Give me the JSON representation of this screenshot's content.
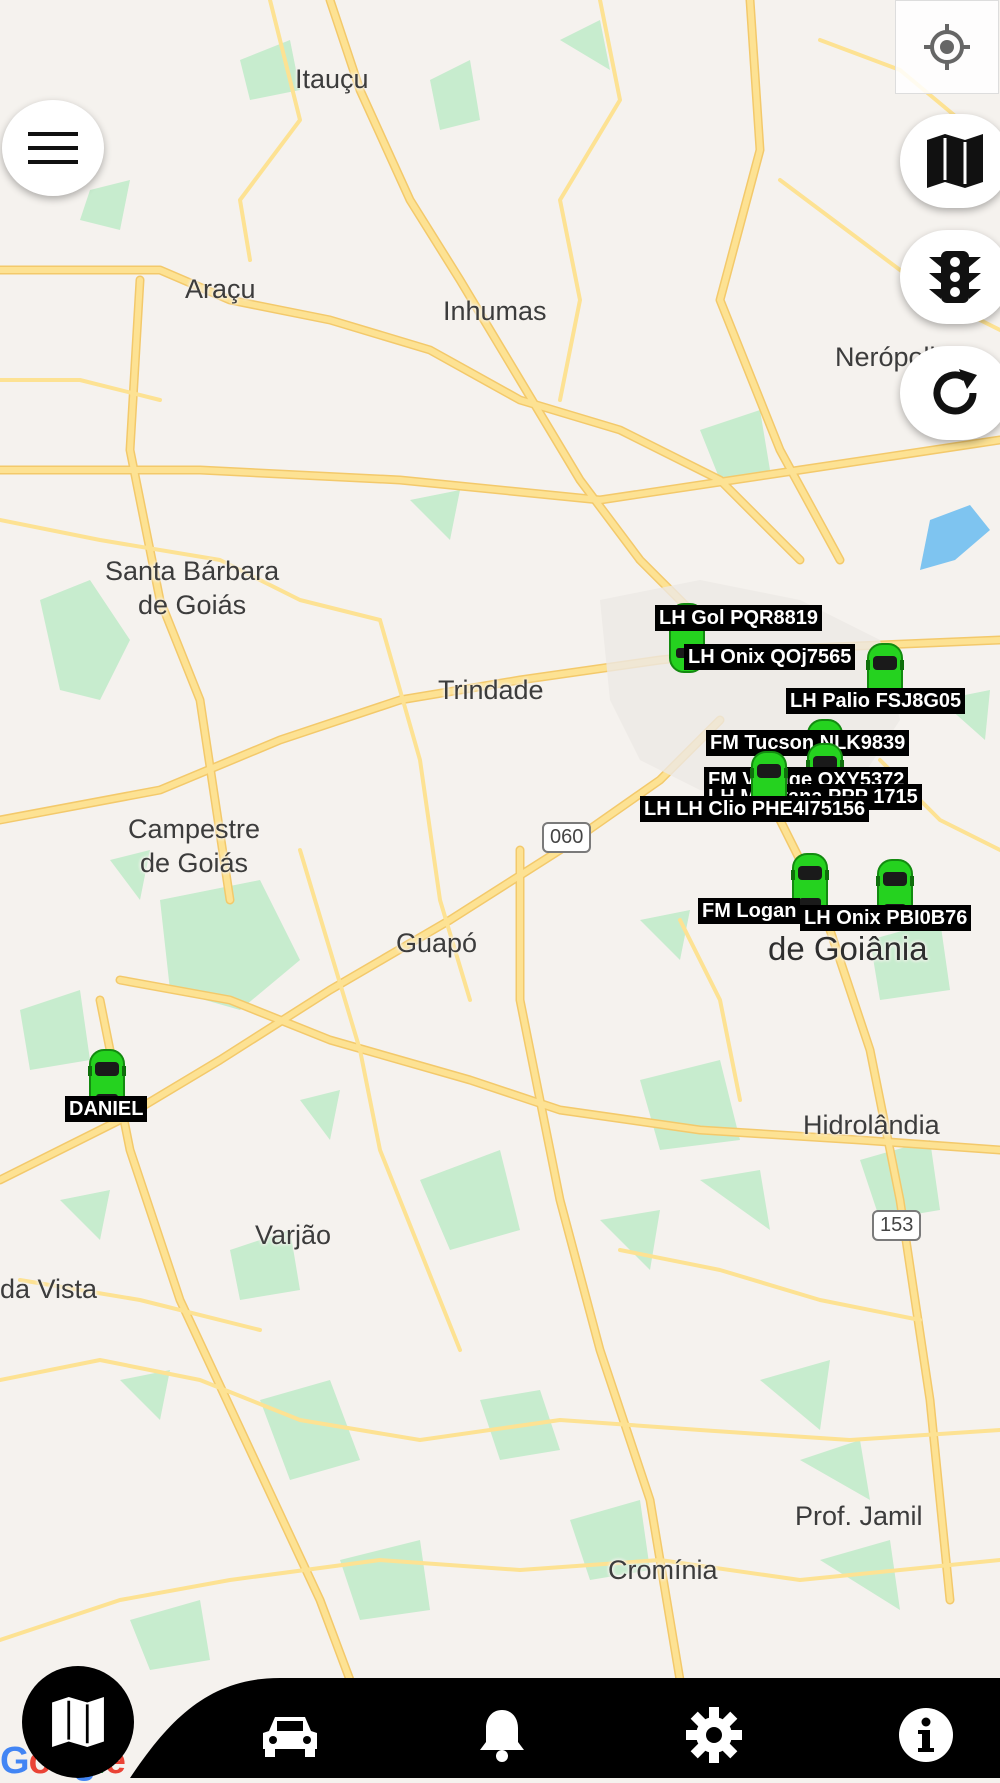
{
  "map": {
    "places": [
      {
        "id": "itaucu",
        "text": "Itauçu"
      },
      {
        "id": "aracu",
        "text": "Araçu"
      },
      {
        "id": "inhumas",
        "text": "Inhumas"
      },
      {
        "id": "neropolis",
        "text": "Nerópolis"
      },
      {
        "id": "santa-barbara",
        "text": "Santa Bárbara\nde Goiás"
      },
      {
        "id": "trindade",
        "text": "Trindade"
      },
      {
        "id": "campestre",
        "text": "Campestre\nde Goiás"
      },
      {
        "id": "guapo",
        "text": "Guapó"
      },
      {
        "id": "aparecida",
        "text": "de Goiânia"
      },
      {
        "id": "hidrolandia",
        "text": "Hidrolândia"
      },
      {
        "id": "varjao",
        "text": "Varjão"
      },
      {
        "id": "boa-vista",
        "text": "da Vista"
      },
      {
        "id": "prof-jamil",
        "text": "Prof. Jamil"
      },
      {
        "id": "crominia",
        "text": "Cromínia"
      }
    ],
    "shields": [
      {
        "id": "go-060",
        "text": "060"
      },
      {
        "id": "br-153",
        "text": "153"
      }
    ],
    "attribution": "Google"
  },
  "vehicles": [
    {
      "id": "gol",
      "label": "LH Gol PQR8819"
    },
    {
      "id": "onix-qoj",
      "label": "LH Onix QOj7565"
    },
    {
      "id": "palio",
      "label": "LH Palio FSJ8G05"
    },
    {
      "id": "tucson",
      "label": "FM Tucson NLK9839"
    },
    {
      "id": "fm-oxy",
      "label": "FM Voyage OXY5372"
    },
    {
      "id": "lh-ppp",
      "label": "LH Montana PPP 1715"
    },
    {
      "id": "clio",
      "label": "LH LH Clio PHE4I75156"
    },
    {
      "id": "logan",
      "label": "FM Logan"
    },
    {
      "id": "onix-pbi",
      "label": "LH Onix PBI0B76"
    },
    {
      "id": "daniel",
      "label": "DANIEL"
    }
  ],
  "colors": {
    "land": "#f5f2ee",
    "park": "#c7ecce",
    "road": "#fde293",
    "road_edge": "#f3c96b",
    "water": "#7ec4f0",
    "car": "#25d21f",
    "bar": "#000000"
  },
  "controls": {
    "menu": "menu-icon",
    "locate": "my-location-icon",
    "map_type": "map-icon",
    "traffic": "traffic-light-icon",
    "refresh": "refresh-icon"
  },
  "bottom_nav": [
    {
      "id": "map",
      "icon": "map-icon",
      "active": true
    },
    {
      "id": "vehicles",
      "icon": "car-icon"
    },
    {
      "id": "alerts",
      "icon": "bell-icon"
    },
    {
      "id": "settings",
      "icon": "gear-icon"
    },
    {
      "id": "info",
      "icon": "info-icon"
    }
  ]
}
